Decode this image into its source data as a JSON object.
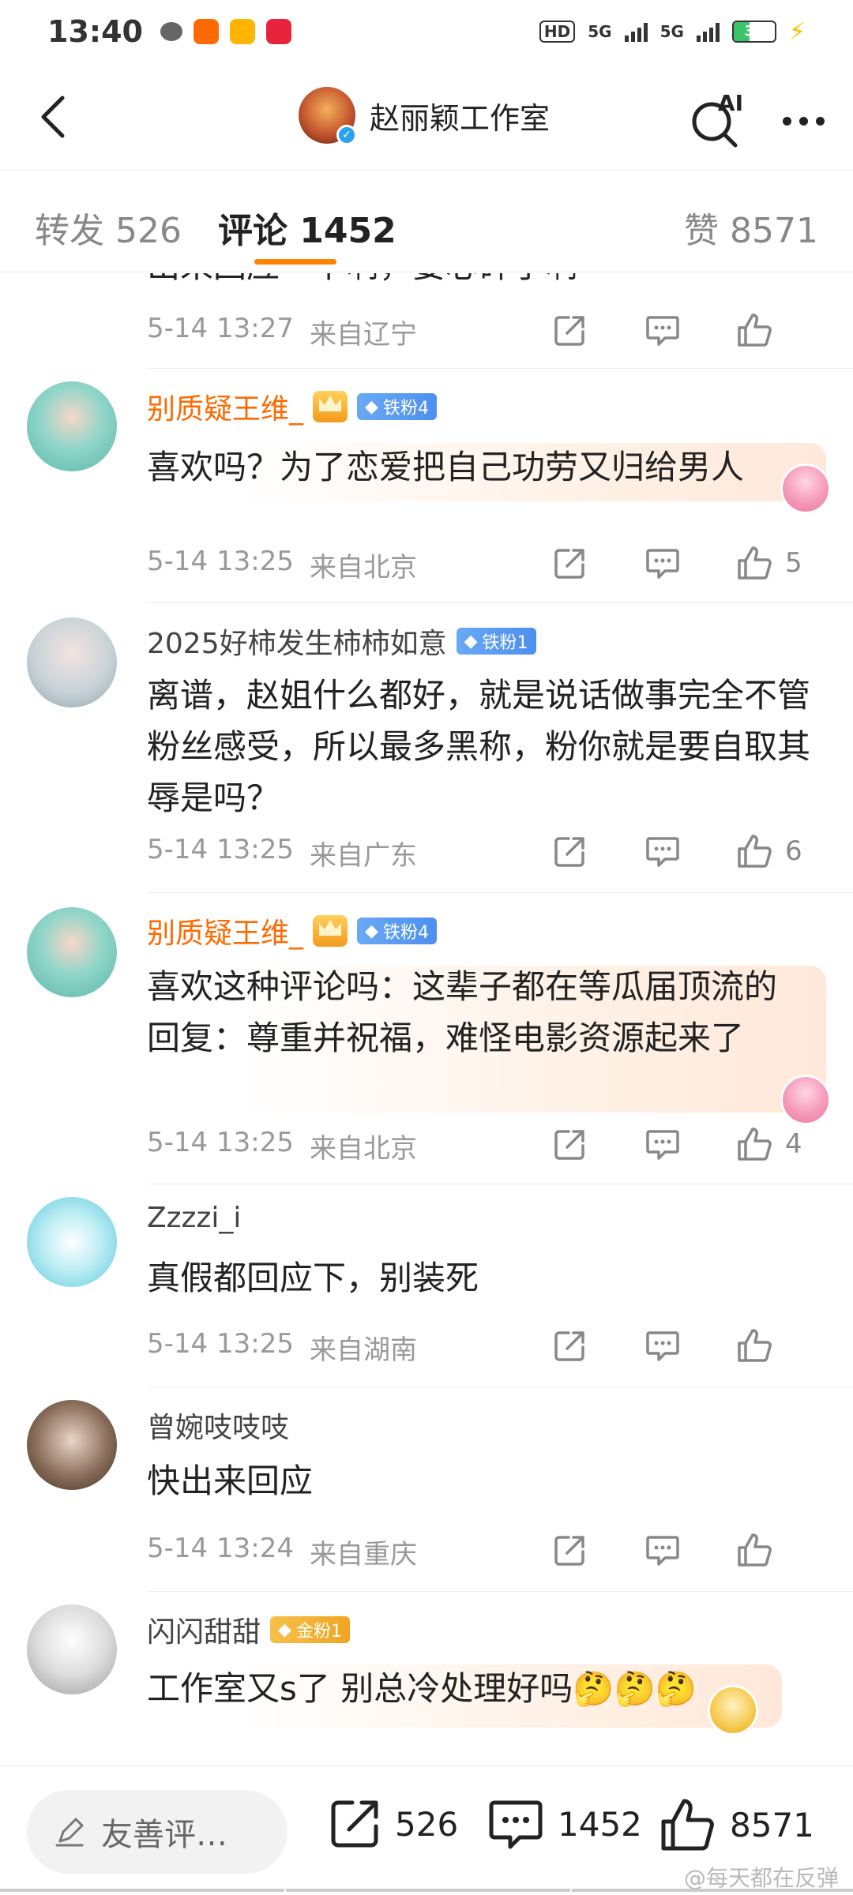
{
  "status_bar": {
    "time": "13:40",
    "network1": "5G",
    "network2": "5G",
    "hd_label": "HD",
    "battery": "39"
  },
  "nav": {
    "title": "赵丽颖工作室",
    "ai_label": "AI"
  },
  "tabs": {
    "repost": "转发 526",
    "comments": "评论 1452",
    "likes": "赞 8571"
  },
  "comments": [
    {
      "user": "",
      "text": "出来回应一下啊，要心碎了啊",
      "time": "5-14 13:27",
      "location": "来自辽宁",
      "likes": ""
    },
    {
      "user": "别质疑王维_",
      "badge": "铁粉4",
      "text": "喜欢吗？为了恋爱把自己功劳又归给男人",
      "time": "5-14 13:25",
      "location": "来自北京",
      "likes": "5"
    },
    {
      "user": "2025好柿发生柿柿如意",
      "badge": "铁粉1",
      "text": "离谱，赵姐什么都好，就是说话做事完全不管粉丝感受，所以最多黑称，粉你就是要自取其辱是吗？",
      "time": "5-14 13:25",
      "location": "来自广东",
      "likes": "6"
    },
    {
      "user": "别质疑王维_",
      "badge": "铁粉4",
      "text": "喜欢这种评论吗：这辈子都在等瓜届顶流的回复：尊重并祝福，难怪电影资源起来了",
      "time": "5-14 13:25",
      "location": "来自北京",
      "likes": "4"
    },
    {
      "user": "Zzzzi_i",
      "text": "真假都回应下，别装死",
      "time": "5-14 13:25",
      "location": "来自湖南",
      "likes": ""
    },
    {
      "user": "曾婉吱吱吱",
      "text": "快出来回应",
      "time": "5-14 13:24",
      "location": "来自重庆",
      "likes": ""
    },
    {
      "user": "闪闪甜甜",
      "badge": "金粉1",
      "text": "工作室又s了 别总冷处理好吗🤔🤔🤔",
      "time": "",
      "location": "",
      "likes": ""
    }
  ],
  "bottom_bar": {
    "input_placeholder": "友善评…",
    "repost_count": "526",
    "comment_count": "1452",
    "like_count": "8571"
  },
  "watermark": "@每天都在反弹",
  "colors": {
    "accent": "#ff8200",
    "vip_name": "#ff6a00",
    "meta_gray": "#999999"
  }
}
